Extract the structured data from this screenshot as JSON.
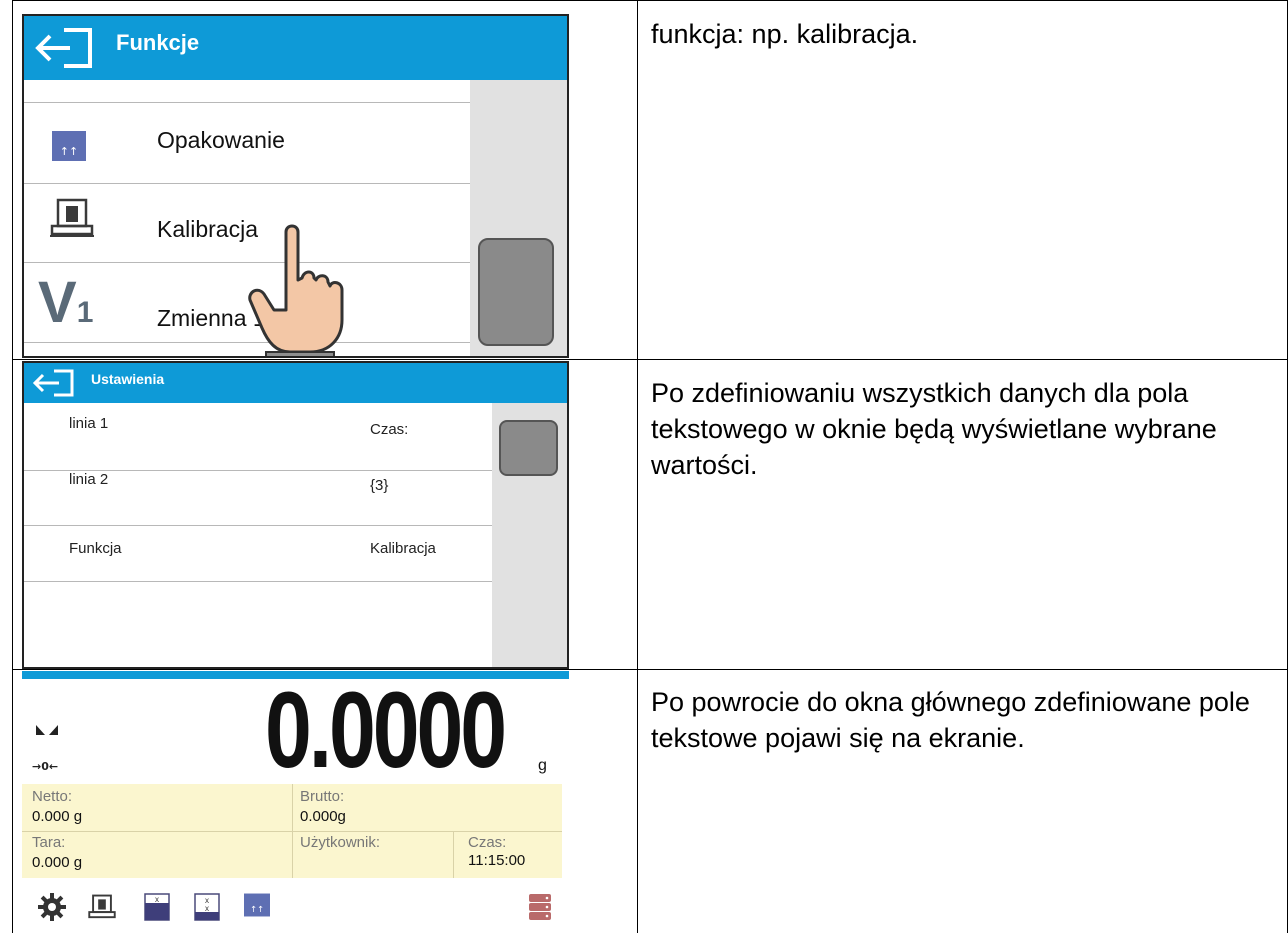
{
  "rows": [
    {
      "description": "funkcja: np. kalibracja."
    },
    {
      "description": "Po zdefiniowaniu wszystkich danych dla pola tekstowego w oknie będą wyświetlane wybrane wartości."
    },
    {
      "description": "Po powrocie do okna głównego zdefiniowane pole tekstowe pojawi się na ekranie."
    }
  ],
  "panel1": {
    "title": "Funkcje",
    "items": [
      {
        "label": "Opakowanie",
        "icon": "packaging-icon"
      },
      {
        "label": "Kalibracja",
        "icon": "calibration-icon"
      },
      {
        "label": "Zmienna 1",
        "icon": "variable-v1-icon",
        "icon_text": "V",
        "icon_sub": "1"
      }
    ]
  },
  "panel2": {
    "title": "Ustawienia",
    "items": [
      {
        "label": "linia 1",
        "value": "Czas:"
      },
      {
        "label": "linia 2",
        "value": "{3}"
      },
      {
        "label": "Funkcja",
        "value": "Kalibracja"
      }
    ]
  },
  "panel3": {
    "reading": "0.0000",
    "unit": "g",
    "zero_marker": "→0←",
    "netto_label": "Netto:",
    "netto_value": "0.000 g",
    "brutto_label": "Brutto:",
    "brutto_value": "0.000g",
    "tara_label": "Tara:",
    "tara_value": "0.000 g",
    "user_label": "Użytkownik:",
    "time_label": "Czas:",
    "time_value": "11:15:00"
  },
  "colors": {
    "header_blue": "#0e9ad7",
    "info_bg": "#fbf6cf",
    "scroll_gray": "#8a8a8a"
  }
}
